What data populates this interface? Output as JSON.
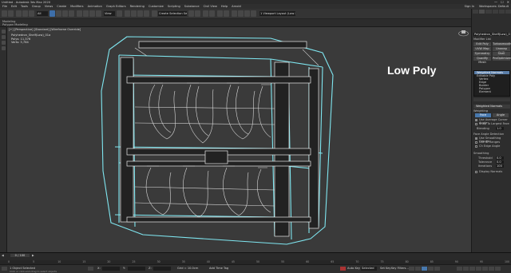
{
  "app": {
    "title": "Untitled - Autodesk 3ds Max 2020",
    "window_controls": [
      "—",
      "☐",
      "✕"
    ]
  },
  "menu": {
    "items": [
      "File",
      "Edit",
      "Tools",
      "Group",
      "Views",
      "Create",
      "Modifiers",
      "Animation",
      "Graph Editors",
      "Rendering",
      "Customize",
      "Scripting",
      "Substance",
      "Civil View",
      "Help",
      "Arnold"
    ],
    "right_items": [
      "Sign In",
      "Workspaces: Default"
    ]
  },
  "toolbar": {
    "selection_filter": "All",
    "view_dropdown": "View",
    "named_selection": "Create Selection Set",
    "workspace_search": "1 Viewport Layout (Low Poly)"
  },
  "ribbon": {
    "row1": "Modeling",
    "row2": "Polygon Modeling"
  },
  "viewport": {
    "label": "[+] [Perspective] [Standard] [Wireframe Override]",
    "stats": {
      "object_name": "Polyhedron_Shelf(Low)_01a",
      "triangles_label": "Polys: 11,376",
      "verts_label": "Verts: 5,784"
    },
    "annotation": "Low Poly"
  },
  "command_panel": {
    "object_name": "Polyhedron_Shelf(Low)_01a",
    "modifier_list_label": "Modifier List",
    "buttons": [
      "Edit Poly",
      "Turbosmooth",
      "UVW Map",
      "Unwrap UVW",
      "Symmetry",
      "Shell",
      "Quadify Mesh",
      "ProOptimizer"
    ],
    "stack": {
      "selected": "Weighted Normals",
      "items": [
        "Weighted Normals",
        "Editable Poly",
        "Vertex",
        "Edge",
        "Border",
        "Polygon",
        "Element"
      ]
    },
    "rollout_title": "Weighted Normals",
    "weighting_label": "Weighting",
    "weight_buttons": [
      "Face",
      "Angle"
    ],
    "options": [
      {
        "label": "Use Average Corner Angle",
        "checked": true
      },
      {
        "label": "Snap To Largest Face",
        "checked": false
      }
    ],
    "blend_label": "Blending",
    "blend_value": "1.0",
    "face_group_label": "Face Angle Detection",
    "face_options": [
      {
        "label": "Use Smoothing Groups",
        "checked": true
      },
      {
        "label": "Use ID Ranges",
        "checked": false
      },
      {
        "label": "Ch Edge Angle",
        "checked": false
      }
    ],
    "smoothing_label": "Smoothing",
    "smoothing_fields": [
      {
        "label": "Threshold",
        "value": "0.0"
      },
      {
        "label": "Tolerance",
        "value": "0.0"
      },
      {
        "label": "Iterations",
        "value": "100"
      }
    ],
    "display_label": "Display Normals",
    "display_checked": false
  },
  "timeline": {
    "frame_display": "0 / 100",
    "ruler_ticks": [
      "0",
      "5",
      "10",
      "15",
      "20",
      "25",
      "30",
      "35",
      "40",
      "45",
      "50",
      "55",
      "60",
      "65",
      "70",
      "75",
      "80",
      "85",
      "90",
      "95",
      "100"
    ]
  },
  "status": {
    "selection": "1 Object Selected",
    "prompt": "Click or click-and-drag to select objects",
    "x_label": "X:",
    "y_label": "Y:",
    "z_label": "Z:",
    "grid": "Grid = 10.0cm",
    "add_time_tag": "Add Time Tag",
    "auto_key": "Auto Key",
    "selected_label": "Selected",
    "set_key": "Set Key",
    "key_filters": "Key Filters..."
  }
}
